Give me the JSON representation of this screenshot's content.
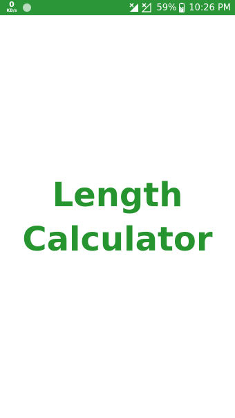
{
  "status_bar": {
    "net_speed_value": "0",
    "net_speed_unit": "KB/s",
    "battery_percent": "59%",
    "time": "10:26 PM",
    "icons": [
      "notification-dot-icon",
      "signal-no-service-icon",
      "signal-no-service-icon",
      "battery-charging-icon"
    ],
    "color": "#2b9638"
  },
  "splash": {
    "title_line1": "Length",
    "title_line2": "Calculator",
    "color": "#27952f"
  }
}
